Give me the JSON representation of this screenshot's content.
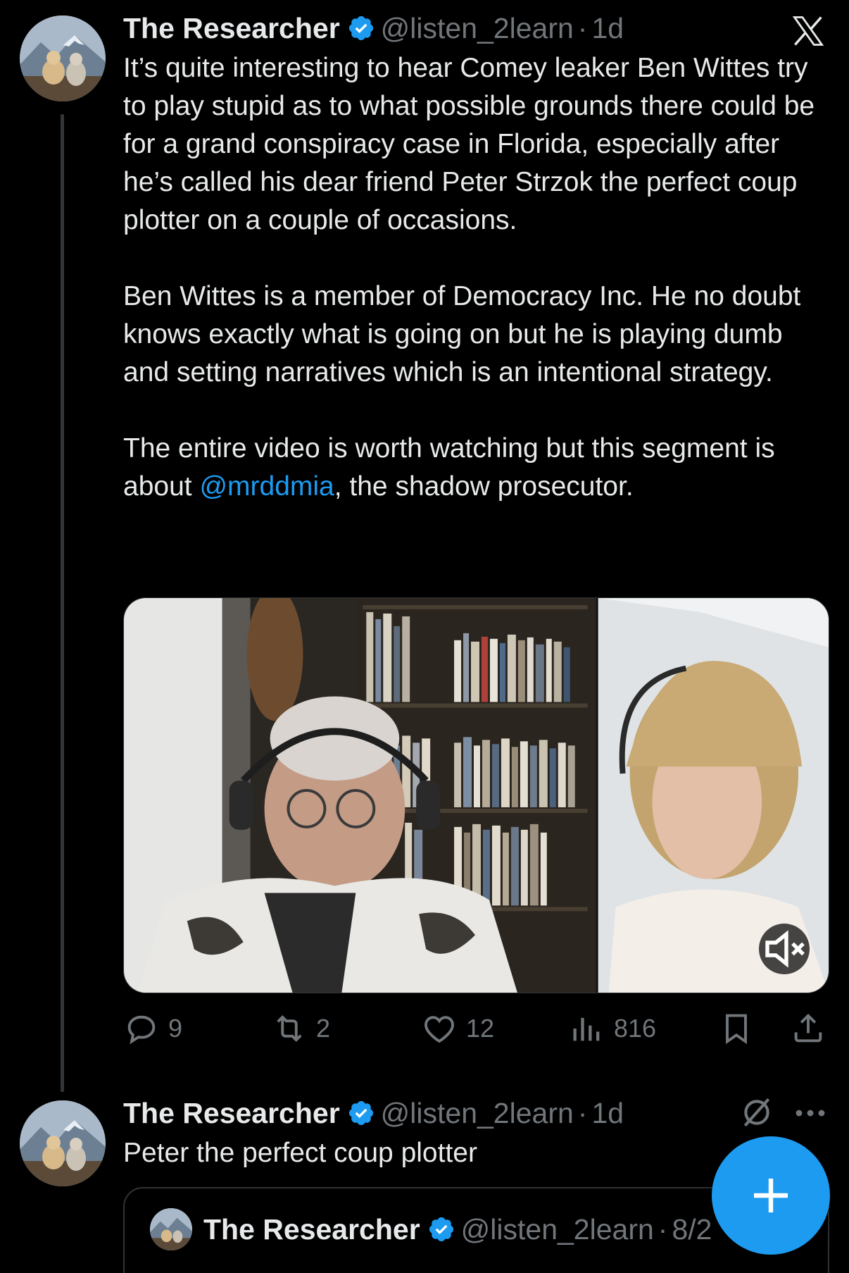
{
  "tweet1": {
    "display_name": "The Researcher",
    "handle": "@listen_2learn",
    "separator": "·",
    "time": "1d",
    "paragraphs": [
      "It’s quite interesting to hear Comey leaker Ben Wittes try to play stupid as to what possible grounds there could be for a grand conspiracy case in Florida, especially after he’s called his dear friend Peter Strzok the perfect coup plotter on a couple of occasions.",
      "Ben Wittes is a member of Democracy Inc. He no doubt knows exactly what is going on but he is playing dumb and setting narratives which is an intentional strategy."
    ],
    "para3_before": "The entire video is worth watching but this segment is about ",
    "mention": "@mrddmia",
    "para3_after": ", the shadow prosecutor.",
    "actions": {
      "replies": "9",
      "reposts": "2",
      "likes": "12",
      "views": "816"
    }
  },
  "tweet2": {
    "display_name": "The Researcher",
    "handle": "@listen_2learn",
    "separator": "·",
    "time": "1d",
    "text": "Peter the perfect coup plotter"
  },
  "quote": {
    "display_name": "The Researcher",
    "handle": "@listen_2learn",
    "separator": "·",
    "time": "8/2"
  },
  "icons": {
    "close": "x-logo-icon",
    "verified": "verified-badge-icon",
    "mute": "volume-muted-icon",
    "reply": "reply-icon",
    "repost": "repost-icon",
    "like": "heart-icon",
    "views": "views-icon",
    "bookmark": "bookmark-icon",
    "share": "share-icon",
    "grok": "grok-icon",
    "more": "more-icon",
    "compose": "plus-icon"
  },
  "colors": {
    "background": "#000000",
    "text": "#e7e9ea",
    "muted": "#71767b",
    "accent": "#1d9bf0"
  }
}
